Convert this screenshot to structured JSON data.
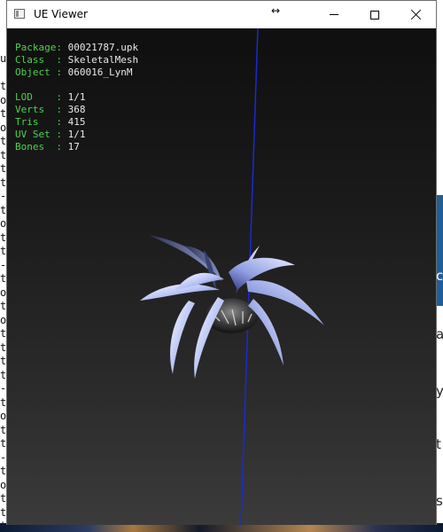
{
  "window": {
    "title": "UE Viewer"
  },
  "titlebar_icons": [
    "app-icon",
    "resize-cursor-icon",
    "minimize-icon",
    "maximize-icon",
    "close-icon"
  ],
  "info": {
    "group1": [
      {
        "label": "Package:",
        "value": "00021787.upk"
      },
      {
        "label": "Class  :",
        "value": "SkeletalMesh"
      },
      {
        "label": "Object :",
        "value": "060016_LynM"
      }
    ],
    "group2": [
      {
        "label": "LOD    :",
        "value": "1/1"
      },
      {
        "label": "Verts  :",
        "value": "368"
      },
      {
        "label": "Tris   :",
        "value": "415"
      },
      {
        "label": "UV Set :",
        "value": "1/1"
      },
      {
        "label": "Bones  :",
        "value": "17"
      }
    ]
  },
  "colors": {
    "label": "#4cd24c",
    "value": "#e8e8e8",
    "axis": "#1a2bd0"
  },
  "background_left_chars": [
    "u",
    "",
    "t",
    "o",
    "t",
    "o",
    "t",
    "t",
    "t",
    "t",
    "-",
    "t",
    "o",
    "t",
    "t",
    "-",
    "t",
    "o",
    "t",
    "o",
    "t",
    "t",
    "t",
    "t",
    "-",
    "t",
    "o",
    "t",
    "t",
    "-",
    "t",
    "o",
    "t",
    "t",
    "t"
  ],
  "background_right_chars": [
    "c",
    "a",
    "y",
    "t",
    "s"
  ]
}
